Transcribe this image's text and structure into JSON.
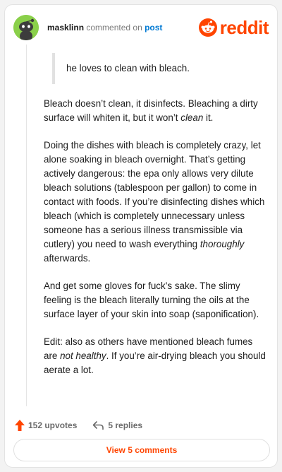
{
  "header": {
    "username": "masklinn",
    "action": " commented on ",
    "post_link": "post",
    "logo_text": "reddit"
  },
  "comment": {
    "quote": "he loves to clean with bleach.",
    "p1_a": "Bleach doesn’t clean, it disinfects. Bleaching a dirty surface will whiten it, but it won’t ",
    "p1_em": "clean",
    "p1_b": " it.",
    "p2_a": "Doing the dishes with bleach is completely crazy, let alone soaking in bleach overnight. That’s getting actively dangerous: the epa only allows very dilute bleach solutions (tablespoon per gallon) to come in contact with foods. If you’re disinfecting dishes which bleach (which is completely unnecessary unless someone has a serious illness transmissible via cutlery) you need to wash everything ",
    "p2_em": "thoroughly",
    "p2_b": " afterwards.",
    "p3": "And get some gloves for fuck’s sake. The slimy feeling is the bleach literally turning the oils at the surface layer of your skin into soap (saponification).",
    "p4_a": "Edit: also as others have mentioned bleach fumes are ",
    "p4_em": "not healthy",
    "p4_b": ". If you’re air-drying bleach you should aerate a lot."
  },
  "footer": {
    "upvotes": "152 upvotes",
    "replies": "5 replies",
    "view_comments": "View 5 comments"
  },
  "colors": {
    "brand": "#ff4500",
    "link": "#0079d3",
    "avatar_bg": "#8ad04a"
  },
  "icons": {
    "avatar": "snoo-avatar-icon",
    "logo": "reddit-snoo-icon",
    "upvote": "upvote-arrow-icon",
    "reply": "reply-arrow-icon"
  }
}
